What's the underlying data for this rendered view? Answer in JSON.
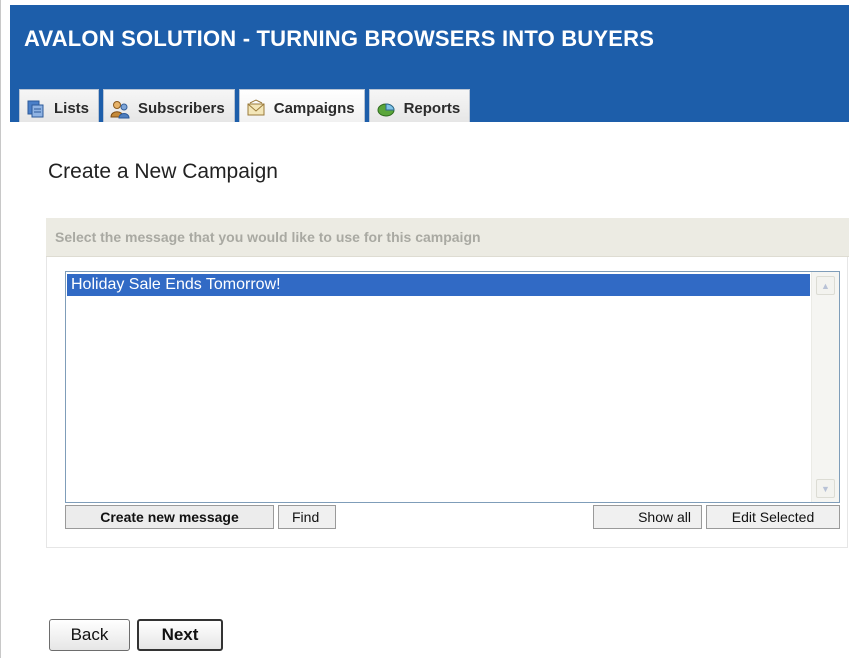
{
  "header": {
    "title": "AVALON SOLUTION - TURNING BROWSERS INTO BUYERS"
  },
  "tabs": [
    {
      "label": "Lists",
      "icon": "lists-icon",
      "active": false
    },
    {
      "label": "Subscribers",
      "icon": "subscribers-icon",
      "active": false
    },
    {
      "label": "Campaigns",
      "icon": "envelope-icon",
      "active": true
    },
    {
      "label": "Reports",
      "icon": "reports-icon",
      "active": false
    }
  ],
  "main": {
    "page_title": "Create a New Campaign",
    "prompt": "Select the message that you would like to use for this campaign",
    "messages": [
      {
        "label": "Holiday Sale Ends Tomorrow!",
        "selected": true
      }
    ],
    "buttons": {
      "create_new": "Create new message",
      "find": "Find",
      "show_all": "Show all",
      "edit_selected": "Edit Selected"
    }
  },
  "footer": {
    "back_label": "Back",
    "next_label": "Next"
  },
  "colors": {
    "header_bg": "#1d5eaa",
    "selection": "#316ac5",
    "prompt_bar": "#ecebe3"
  }
}
